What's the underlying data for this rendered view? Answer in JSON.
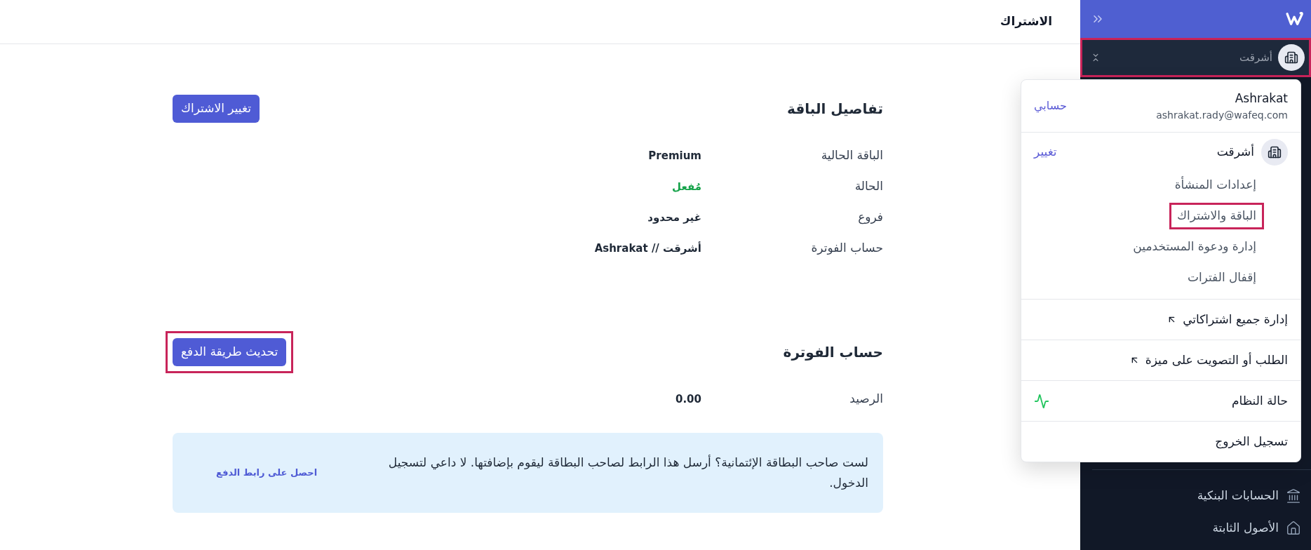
{
  "sidebar": {
    "org_selector": {
      "name": "أشرقت",
      "highlighted": true
    },
    "nav_items": [
      {
        "label": "الحسابات البنكية",
        "kind": "bank"
      },
      {
        "label": "الأصول الثابتة",
        "kind": "assets"
      }
    ]
  },
  "header": {
    "title": "الاشتراك"
  },
  "plan_details": {
    "title": "تفاصيل الباقة",
    "button": {
      "label": "تغيير الاشتراك",
      "highlighted": false
    },
    "rows": [
      {
        "label": "الباقة الحالية",
        "value": "Premium",
        "kind": "text"
      },
      {
        "label": "الحالة",
        "value": "مُفعل",
        "kind": "status"
      },
      {
        "label": "فروع",
        "value": "غير محدود",
        "kind": "text"
      },
      {
        "label": "حساب الفوترة",
        "value": "أشرقت // Ashrakat",
        "kind": "text"
      }
    ]
  },
  "billing_account": {
    "title": "حساب الفوترة",
    "button": {
      "label": "تحديث طريقة الدفع",
      "highlighted": true
    },
    "rows": [
      {
        "label": "الرصيد",
        "value": "0.00",
        "kind": "text"
      }
    ],
    "notice": {
      "text": "لست صاحب البطاقة الإئتمانية؟ أرسل هذا الرابط لصاحب البطاقة ليقوم بإضافتها. لا داعي لتسجيل الدخول.",
      "link": "احصل على رابط الدفع"
    }
  },
  "user_menu": {
    "user": {
      "name": "Ashrakat",
      "email": "ashrakat.rady@wafeq.com",
      "link": "حسابي"
    },
    "organization": {
      "name": "أشرقت",
      "link": "تغيير",
      "items": [
        {
          "label": "إعدادات المنشأة",
          "highlighted": false
        },
        {
          "label": "الباقة والاشتراك",
          "highlighted": true
        },
        {
          "label": "إدارة ودعوة المستخدمين",
          "highlighted": false
        },
        {
          "label": "إقفال الفترات",
          "highlighted": false
        }
      ]
    },
    "items": [
      {
        "label": "إدارة جميع اشتراكاتي",
        "kind": "external"
      },
      {
        "label": "الطلب أو التصويت على ميزة",
        "kind": "external"
      },
      {
        "label": "حالة النظام",
        "kind": "status"
      },
      {
        "label": "تسجيل الخروج",
        "kind": "plain"
      }
    ]
  }
}
